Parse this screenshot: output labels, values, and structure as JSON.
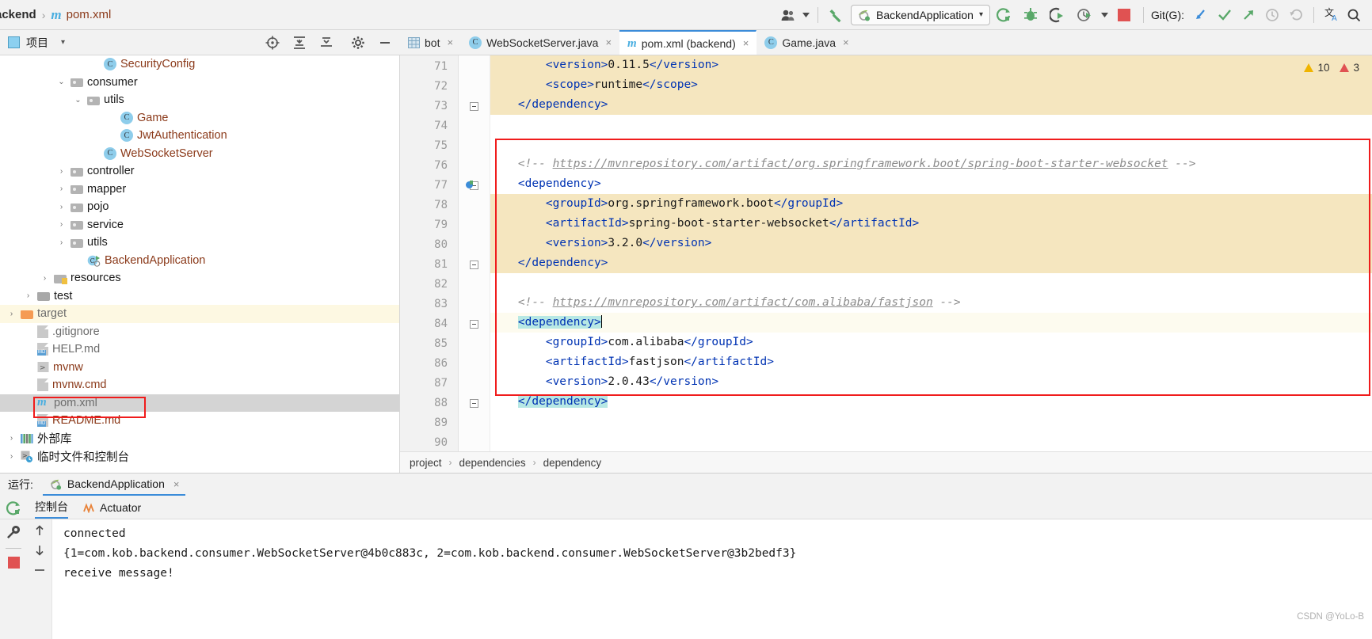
{
  "titlebar": {
    "breadcrumb_project": "ackend",
    "breadcrumb_sep": "›",
    "maven_icon": "m",
    "breadcrumb_file": "pom.xml",
    "profile_icon": "user-group-icon",
    "build_icon": "hammer-icon",
    "run_config": {
      "icon": "spring-boot-icon",
      "label": "BackendApplication",
      "caret": "▾"
    },
    "rerun_icon": "rerun-icon",
    "debug_icon": "debug-icon",
    "coverage_icon": "run-with-coverage-icon",
    "profiler_icon": "profiler-icon",
    "profiler_caret": "▾",
    "stop_icon": "stop-icon",
    "git_label": "Git(G):",
    "git_update_icon": "update-project-icon",
    "git_commit_icon": "commit-icon",
    "git_push_icon": "push-icon",
    "history_icon": "history-icon",
    "undo_icon": "undo-icon",
    "translate_icon": "translate-icon",
    "search_icon": "search-icon"
  },
  "project_toolbar": {
    "panel_icon": "project-panel-icon",
    "title": "项目",
    "caret": "▾",
    "locate_icon": "select-opened-file-icon",
    "expand_icon": "expand-all-icon",
    "collapse_icon": "collapse-all-icon",
    "settings_icon": "gear-icon",
    "hide_icon": "hide-panel-icon"
  },
  "editor_tabs": [
    {
      "label": "bot",
      "icon": "table-icon",
      "icon_kind": "table",
      "active": false,
      "close": "×"
    },
    {
      "label": "WebSocketServer.java",
      "icon": "class-icon",
      "icon_kind": "class",
      "active": false,
      "close": "×"
    },
    {
      "label": "pom.xml (backend)",
      "icon": "maven-icon",
      "icon_kind": "maven",
      "active": true,
      "close": "×"
    },
    {
      "label": "Game.java",
      "icon": "class-icon",
      "icon_kind": "class",
      "active": false,
      "close": "×"
    }
  ],
  "project_tree": [
    {
      "label": "SecurityConfig",
      "indent": 5,
      "icon": "class-icon",
      "kind": "class",
      "arrow": "",
      "color": "orange",
      "state": ""
    },
    {
      "label": "consumer",
      "indent": 3,
      "icon": "folder-icon",
      "kind": "folder",
      "arrow": "⌄",
      "color": "dark",
      "state": ""
    },
    {
      "label": "utils",
      "indent": 4,
      "icon": "folder-icon",
      "kind": "folder",
      "arrow": "⌄",
      "color": "dark",
      "state": ""
    },
    {
      "label": "Game",
      "indent": 6,
      "icon": "class-icon",
      "kind": "class",
      "arrow": "",
      "color": "orange",
      "state": ""
    },
    {
      "label": "JwtAuthentication",
      "indent": 6,
      "icon": "class-icon",
      "kind": "class",
      "arrow": "",
      "color": "orange",
      "state": ""
    },
    {
      "label": "WebSocketServer",
      "indent": 5,
      "icon": "class-icon",
      "kind": "class",
      "arrow": "",
      "color": "orange",
      "state": ""
    },
    {
      "label": "controller",
      "indent": 3,
      "icon": "folder-icon",
      "kind": "folder",
      "arrow": "›",
      "color": "dark",
      "state": ""
    },
    {
      "label": "mapper",
      "indent": 3,
      "icon": "folder-icon",
      "kind": "folder",
      "arrow": "›",
      "color": "dark",
      "state": ""
    },
    {
      "label": "pojo",
      "indent": 3,
      "icon": "folder-icon",
      "kind": "folder",
      "arrow": "›",
      "color": "dark",
      "state": ""
    },
    {
      "label": "service",
      "indent": 3,
      "icon": "folder-icon",
      "kind": "folder",
      "arrow": "›",
      "color": "dark",
      "state": ""
    },
    {
      "label": "utils",
      "indent": 3,
      "icon": "folder-icon",
      "kind": "folder",
      "arrow": "›",
      "color": "dark",
      "state": ""
    },
    {
      "label": "BackendApplication",
      "indent": 4,
      "icon": "spring-class-icon",
      "kind": "springclass",
      "arrow": "",
      "color": "orange",
      "state": ""
    },
    {
      "label": "resources",
      "indent": 2,
      "icon": "resources-folder-icon",
      "kind": "resfolder",
      "arrow": "›",
      "color": "dark",
      "state": ""
    },
    {
      "label": "test",
      "indent": 1,
      "icon": "folder-icon",
      "kind": "folderplain",
      "arrow": "›",
      "color": "dark",
      "state": ""
    },
    {
      "label": "target",
      "indent": 0,
      "icon": "folder-icon",
      "kind": "folderorange",
      "arrow": "›",
      "color": "gray",
      "state": "target"
    },
    {
      "label": ".gitignore",
      "indent": 1,
      "icon": "gitignore-icon",
      "kind": "doc",
      "arrow": "",
      "color": "gray",
      "state": ""
    },
    {
      "label": "HELP.md",
      "indent": 1,
      "icon": "markdown-icon",
      "kind": "md",
      "arrow": "",
      "color": "gray",
      "state": ""
    },
    {
      "label": "mvnw",
      "indent": 1,
      "icon": "script-icon",
      "kind": "script",
      "arrow": "",
      "color": "orange",
      "state": ""
    },
    {
      "label": "mvnw.cmd",
      "indent": 1,
      "icon": "file-icon",
      "kind": "doc",
      "arrow": "",
      "color": "orange",
      "state": ""
    },
    {
      "label": "pom.xml",
      "indent": 1,
      "icon": "maven-icon",
      "kind": "maven",
      "arrow": "",
      "color": "gray",
      "state": "selected"
    },
    {
      "label": "README.md",
      "indent": 1,
      "icon": "markdown-icon",
      "kind": "md",
      "arrow": "",
      "color": "orange",
      "state": ""
    },
    {
      "label": "外部库",
      "indent": 0,
      "icon": "external-libraries-icon",
      "kind": "lib",
      "arrow": "›",
      "color": "dark",
      "state": ""
    },
    {
      "label": "临时文件和控制台",
      "indent": 0,
      "icon": "scratches-icon",
      "kind": "scratch",
      "arrow": "›",
      "color": "dark",
      "state": ""
    }
  ],
  "editor": {
    "warnings": {
      "warn_count": "10",
      "error_count": "3"
    },
    "lines": [
      {
        "num": "71",
        "highlight": "block",
        "indent": 8,
        "parts": [
          {
            "t": "tag",
            "v": "<version>"
          },
          {
            "t": "text",
            "v": "0.11.5"
          },
          {
            "t": "tag",
            "v": "</version>"
          }
        ]
      },
      {
        "num": "72",
        "highlight": "block",
        "indent": 8,
        "parts": [
          {
            "t": "tag",
            "v": "<scope>"
          },
          {
            "t": "text",
            "v": "runtime"
          },
          {
            "t": "tag",
            "v": "</scope>"
          }
        ]
      },
      {
        "num": "73",
        "highlight": "block",
        "indent": 4,
        "fold": true,
        "parts": [
          {
            "t": "tag",
            "v": "</dependency>"
          }
        ]
      },
      {
        "num": "74",
        "highlight": "",
        "indent": 0,
        "parts": []
      },
      {
        "num": "75",
        "highlight": "",
        "indent": 0,
        "parts": []
      },
      {
        "num": "76",
        "highlight": "",
        "indent": 4,
        "parts": [
          {
            "t": "cmt",
            "v": "<!-- "
          },
          {
            "t": "url",
            "v": "https://mvnrepository.com/artifact/org.springframework.boot/spring-boot-starter-websocket"
          },
          {
            "t": "cmt",
            "v": " -->"
          }
        ]
      },
      {
        "num": "77",
        "highlight": "",
        "indent": 4,
        "fold": true,
        "breakpoint": true,
        "parts": [
          {
            "t": "tag",
            "v": "<dependency>"
          }
        ]
      },
      {
        "num": "78",
        "highlight": "block",
        "indent": 8,
        "parts": [
          {
            "t": "tag",
            "v": "<groupId>"
          },
          {
            "t": "text",
            "v": "org.springframework.boot"
          },
          {
            "t": "tag",
            "v": "</groupId>"
          }
        ]
      },
      {
        "num": "79",
        "highlight": "block",
        "indent": 8,
        "parts": [
          {
            "t": "tag",
            "v": "<artifactId>"
          },
          {
            "t": "text",
            "v": "spring-boot-starter-websocket"
          },
          {
            "t": "tag",
            "v": "</artifactId>"
          }
        ]
      },
      {
        "num": "80",
        "highlight": "block",
        "indent": 8,
        "parts": [
          {
            "t": "tag",
            "v": "<version>"
          },
          {
            "t": "text",
            "v": "3.2.0"
          },
          {
            "t": "tag",
            "v": "</version>"
          }
        ]
      },
      {
        "num": "81",
        "highlight": "block",
        "indent": 4,
        "fold": true,
        "parts": [
          {
            "t": "tag",
            "v": "</dependency>"
          }
        ]
      },
      {
        "num": "82",
        "highlight": "",
        "indent": 0,
        "parts": []
      },
      {
        "num": "83",
        "highlight": "",
        "indent": 4,
        "parts": [
          {
            "t": "cmt",
            "v": "<!-- "
          },
          {
            "t": "url",
            "v": "https://mvnrepository.com/artifact/com.alibaba/fastjson"
          },
          {
            "t": "cmt",
            "v": " -->"
          }
        ]
      },
      {
        "num": "84",
        "highlight": "caret",
        "indent": 4,
        "fold": true,
        "parts": [
          {
            "t": "sel",
            "v": "<dependency>"
          },
          {
            "t": "caret",
            "v": ""
          }
        ]
      },
      {
        "num": "85",
        "highlight": "",
        "indent": 8,
        "parts": [
          {
            "t": "tag",
            "v": "<groupId>"
          },
          {
            "t": "text",
            "v": "com.alibaba"
          },
          {
            "t": "tag",
            "v": "</groupId>"
          }
        ]
      },
      {
        "num": "86",
        "highlight": "",
        "indent": 8,
        "parts": [
          {
            "t": "tag",
            "v": "<artifactId>"
          },
          {
            "t": "text",
            "v": "fastjson"
          },
          {
            "t": "tag",
            "v": "</artifactId>"
          }
        ]
      },
      {
        "num": "87",
        "highlight": "",
        "indent": 8,
        "parts": [
          {
            "t": "tag",
            "v": "<version>"
          },
          {
            "t": "text",
            "v": "2.0.43"
          },
          {
            "t": "tag",
            "v": "</version>"
          }
        ]
      },
      {
        "num": "88",
        "highlight": "",
        "indent": 4,
        "fold": true,
        "parts": [
          {
            "t": "sel",
            "v": "</dependency>"
          }
        ]
      },
      {
        "num": "89",
        "highlight": "",
        "indent": 0,
        "parts": []
      },
      {
        "num": "90",
        "highlight": "",
        "indent": 0,
        "parts": []
      }
    ]
  },
  "breadcrumb": [
    "project",
    "dependencies",
    "dependency"
  ],
  "breadcrumb_sep": "›",
  "run_panel": {
    "run_label": "运行:",
    "tab_icon": "spring-boot-icon",
    "tab_label": "BackendApplication",
    "tab_close": "×",
    "subtabs": [
      {
        "label": "控制台",
        "icon": "",
        "active": true
      },
      {
        "label": "Actuator",
        "icon": "actuator-icon",
        "active": false
      }
    ],
    "rail_icons": [
      "rerun-icon",
      "wrench-icon",
      "stop-icon"
    ],
    "rail2_icons": [
      "scroll-up-icon",
      "scroll-down-icon",
      "soft-wrap-icon"
    ],
    "console_lines": [
      "connected",
      "{1=com.kob.backend.consumer.WebSocketServer@4b0c883c, 2=com.kob.backend.consumer.WebSocketServer@3b2bedf3}",
      "receive message!"
    ]
  },
  "watermark": "CSDN @YoLo-B",
  "colors": {
    "accent_blue": "#3b8cd9",
    "tag": "#0033b3",
    "comment": "#8c8c8c",
    "orange_text": "#8b3a1a",
    "highlight_block": "#f5e6bf",
    "selection_teal": "#b7e8e4",
    "red_annotation": "#f01c1c",
    "green": "#59a869"
  }
}
